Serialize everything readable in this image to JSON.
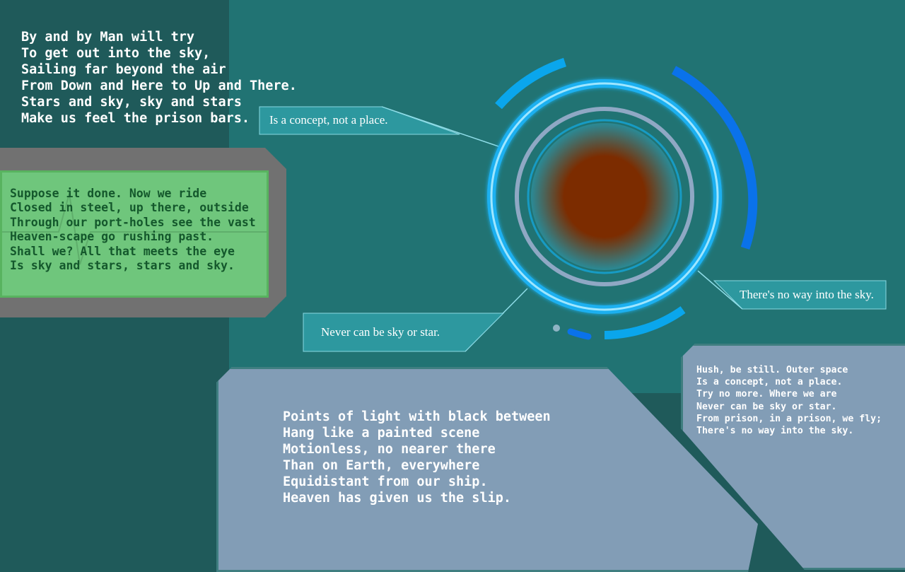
{
  "poem_top": {
    "lines": [
      "By and by Man will try",
      "To get out into the sky,",
      "Sailing far beyond the air",
      "From Down and Here to Up and There.",
      "Stars and sky, sky and stars",
      "Make us feel the prison bars."
    ]
  },
  "poem_screen": {
    "lines": [
      "Suppose it done. Now we ride",
      "Closed in steel, up there, outside",
      "Through our port-holes see the vast",
      "Heaven-scape go rushing past.",
      "Shall we? All that meets the eye",
      "Is sky and stars, stars and sky."
    ]
  },
  "callouts": {
    "concept": "Is a concept, not a place.",
    "never": "Never can be sky or star.",
    "no_way": "There's no way into the sky."
  },
  "poem_big": {
    "lines": [
      "Points of light with black between",
      "Hang like a painted scene",
      "Motionless, no nearer there",
      "Than on Earth, everywhere",
      "Equidistant from our ship.",
      "Heaven has given us the slip."
    ]
  },
  "poem_right": {
    "lines": [
      "Hush, be still. Outer space",
      "Is a concept, not a place.",
      "Try no more. Where we are",
      "Never can be sky or star.",
      "From prison, in a prison, we fly;",
      "There's no way into the sky."
    ]
  },
  "colors": {
    "background": "#217373",
    "screen_green": "#6fc67c",
    "panel_blue": "#829db6",
    "planet_red": "#7c2c00",
    "ring_blue": "#1fb0f0"
  }
}
